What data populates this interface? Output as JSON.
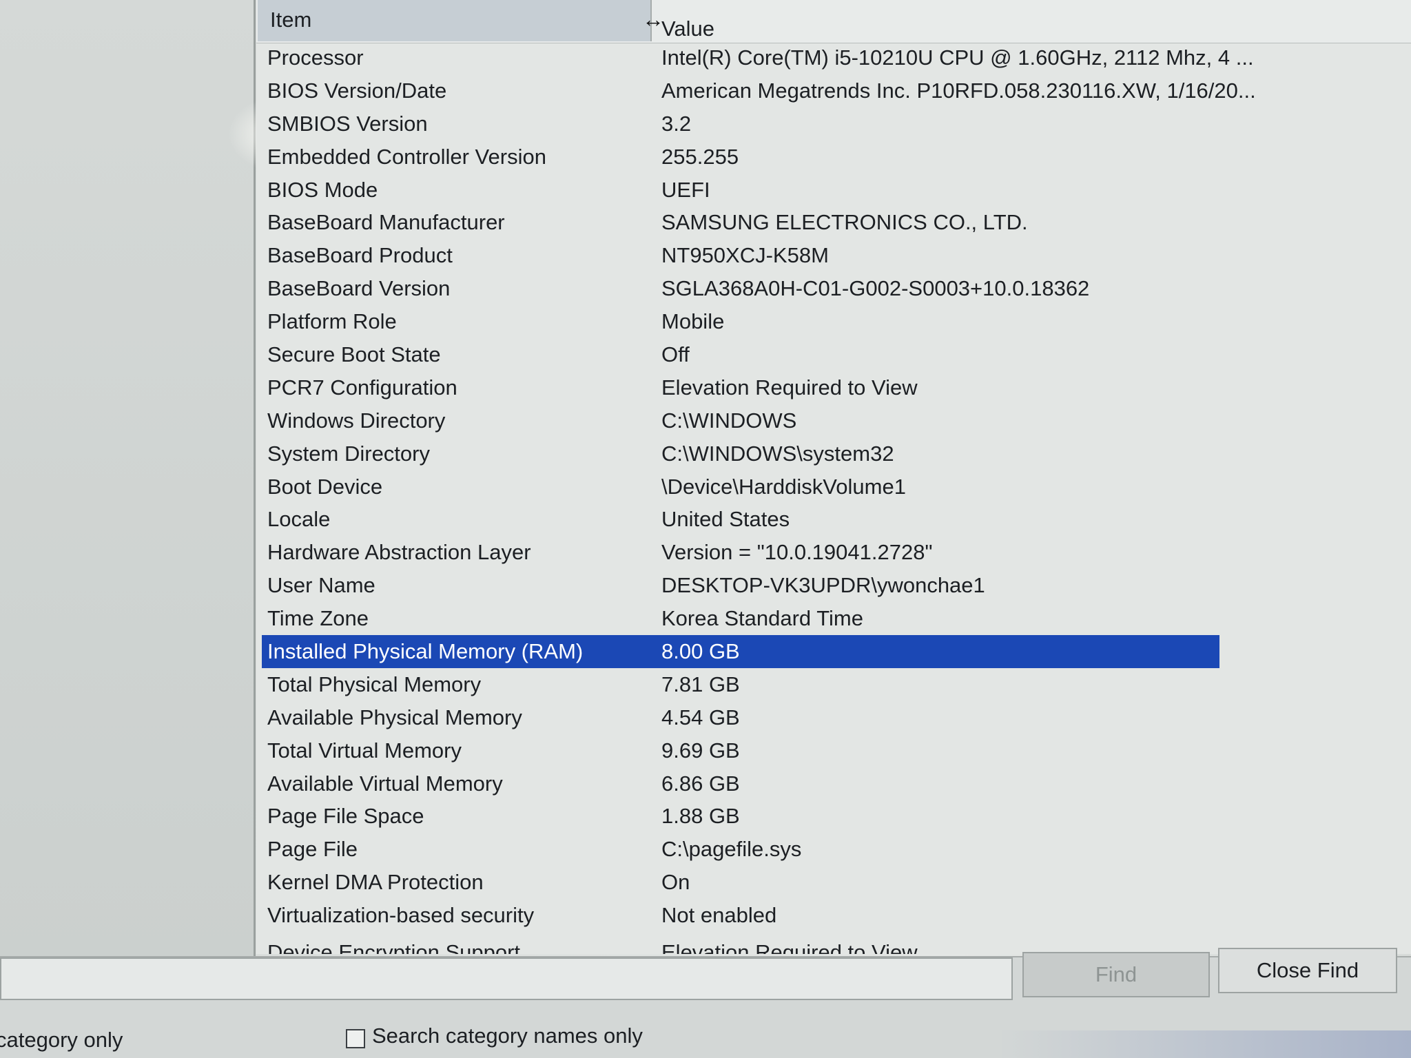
{
  "header": {
    "item_label": "Item",
    "value_label": "Value"
  },
  "rows": [
    {
      "item": "Processor",
      "value": "Intel(R) Core(TM) i5-10210U CPU @ 1.60GHz, 2112 Mhz, 4 ..."
    },
    {
      "item": "BIOS Version/Date",
      "value": "American Megatrends Inc. P10RFD.058.230116.XW, 1/16/20..."
    },
    {
      "item": "SMBIOS Version",
      "value": "3.2"
    },
    {
      "item": "Embedded Controller Version",
      "value": "255.255"
    },
    {
      "item": "BIOS Mode",
      "value": "UEFI"
    },
    {
      "item": "BaseBoard Manufacturer",
      "value": "SAMSUNG ELECTRONICS CO., LTD."
    },
    {
      "item": "BaseBoard Product",
      "value": "NT950XCJ-K58M"
    },
    {
      "item": "BaseBoard Version",
      "value": "SGLA368A0H-C01-G002-S0003+10.0.18362"
    },
    {
      "item": "Platform Role",
      "value": "Mobile"
    },
    {
      "item": "Secure Boot State",
      "value": "Off"
    },
    {
      "item": "PCR7 Configuration",
      "value": "Elevation Required to View"
    },
    {
      "item": "Windows Directory",
      "value": "C:\\WINDOWS"
    },
    {
      "item": "System Directory",
      "value": "C:\\WINDOWS\\system32"
    },
    {
      "item": "Boot Device",
      "value": "\\Device\\HarddiskVolume1"
    },
    {
      "item": "Locale",
      "value": "United States"
    },
    {
      "item": "Hardware Abstraction Layer",
      "value": "Version = \"10.0.19041.2728\""
    },
    {
      "item": "User Name",
      "value": "DESKTOP-VK3UPDR\\ywonchae1"
    },
    {
      "item": "Time Zone",
      "value": "Korea Standard Time"
    },
    {
      "item": "Installed Physical Memory (RAM)",
      "value": "8.00 GB"
    },
    {
      "item": "Total Physical Memory",
      "value": "7.81 GB"
    },
    {
      "item": "Available Physical Memory",
      "value": "4.54 GB"
    },
    {
      "item": "Total Virtual Memory",
      "value": "9.69 GB"
    },
    {
      "item": "Available Virtual Memory",
      "value": "6.86 GB"
    },
    {
      "item": "Page File Space",
      "value": "1.88 GB"
    },
    {
      "item": "Page File",
      "value": "C:\\pagefile.sys"
    },
    {
      "item": "Kernel DMA Protection",
      "value": "On"
    },
    {
      "item": "Virtualization-based security",
      "value": "Not enabled"
    },
    {
      "item": "Device Encryption Support",
      "value": "Elevation Required to View"
    }
  ],
  "selected_row_index": 18,
  "find": {
    "input_value": "",
    "find_button": "Find",
    "close_find_button": "Close Find"
  },
  "options": {
    "category_only_label": "category only",
    "search_category_names_only_label": "Search category names only",
    "search_category_names_only_checked": false
  },
  "colors": {
    "selection": "#1b48b5",
    "header_item_bg": "#c6ced4"
  }
}
